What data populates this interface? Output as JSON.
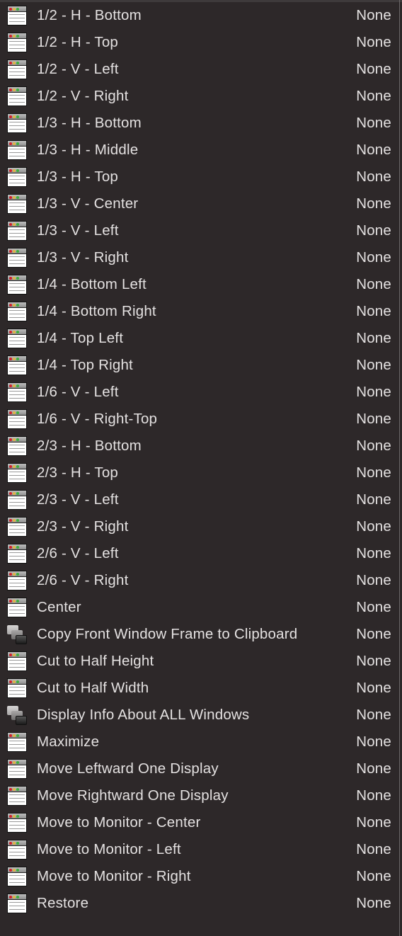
{
  "items": [
    {
      "label": "1/2 - H - Bottom",
      "shortcut": "None",
      "icon": "window-icon"
    },
    {
      "label": "1/2 - H - Top",
      "shortcut": "None",
      "icon": "window-icon"
    },
    {
      "label": "1/2 - V - Left",
      "shortcut": "None",
      "icon": "window-icon"
    },
    {
      "label": "1/2 - V - Right",
      "shortcut": "None",
      "icon": "window-icon"
    },
    {
      "label": "1/3 - H - Bottom",
      "shortcut": "None",
      "icon": "window-icon"
    },
    {
      "label": "1/3 - H - Middle",
      "shortcut": "None",
      "icon": "window-icon"
    },
    {
      "label": "1/3 - H - Top",
      "shortcut": "None",
      "icon": "window-icon"
    },
    {
      "label": "1/3 - V - Center",
      "shortcut": "None",
      "icon": "window-icon"
    },
    {
      "label": "1/3 - V - Left",
      "shortcut": "None",
      "icon": "window-icon"
    },
    {
      "label": "1/3 - V - Right",
      "shortcut": "None",
      "icon": "window-icon"
    },
    {
      "label": "1/4 - Bottom Left",
      "shortcut": "None",
      "icon": "window-icon"
    },
    {
      "label": "1/4 - Bottom Right",
      "shortcut": "None",
      "icon": "window-icon"
    },
    {
      "label": "1/4 - Top Left",
      "shortcut": "None",
      "icon": "window-icon"
    },
    {
      "label": "1/4 - Top Right",
      "shortcut": "None",
      "icon": "window-icon"
    },
    {
      "label": "1/6 - V - Left",
      "shortcut": "None",
      "icon": "window-icon"
    },
    {
      "label": "1/6 - V - Right-Top",
      "shortcut": "None",
      "icon": "window-icon"
    },
    {
      "label": "2/3 - H - Bottom",
      "shortcut": "None",
      "icon": "window-icon"
    },
    {
      "label": "2/3 - H - Top",
      "shortcut": "None",
      "icon": "window-icon"
    },
    {
      "label": "2/3 - V - Left",
      "shortcut": "None",
      "icon": "window-icon"
    },
    {
      "label": "2/3 - V - Right",
      "shortcut": "None",
      "icon": "window-icon"
    },
    {
      "label": "2/6 - V - Left",
      "shortcut": "None",
      "icon": "window-icon"
    },
    {
      "label": "2/6 - V - Right",
      "shortcut": "None",
      "icon": "window-icon"
    },
    {
      "label": "Center",
      "shortcut": "None",
      "icon": "window-icon"
    },
    {
      "label": "Copy Front Window Frame to Clipboard",
      "shortcut": "None",
      "icon": "stacked-windows-icon"
    },
    {
      "label": "Cut to Half Height",
      "shortcut": "None",
      "icon": "window-icon"
    },
    {
      "label": "Cut to Half Width",
      "shortcut": "None",
      "icon": "window-icon"
    },
    {
      "label": "Display Info About ALL Windows",
      "shortcut": "None",
      "icon": "stacked-windows-icon"
    },
    {
      "label": "Maximize",
      "shortcut": "None",
      "icon": "window-icon"
    },
    {
      "label": "Move Leftward One Display",
      "shortcut": "None",
      "icon": "window-icon"
    },
    {
      "label": "Move Rightward One Display",
      "shortcut": "None",
      "icon": "window-icon"
    },
    {
      "label": "Move to Monitor - Center",
      "shortcut": "None",
      "icon": "window-icon"
    },
    {
      "label": "Move to Monitor - Left",
      "shortcut": "None",
      "icon": "window-icon"
    },
    {
      "label": "Move to Monitor - Right",
      "shortcut": "None",
      "icon": "window-icon"
    },
    {
      "label": "Restore",
      "shortcut": "None",
      "icon": "window-icon"
    }
  ]
}
